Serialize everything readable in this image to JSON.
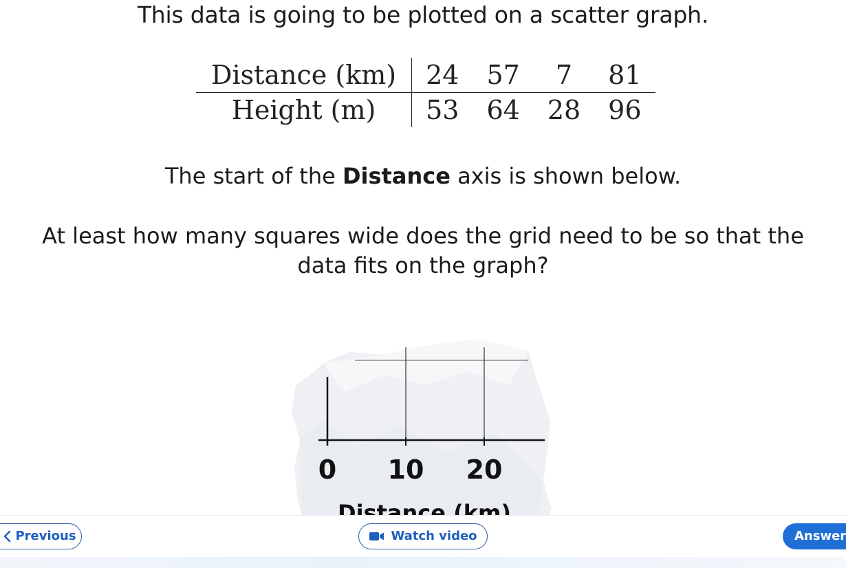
{
  "intro_text": "This data is going to be plotted on a scatter graph.",
  "table": {
    "row1_label": "Distance (km)",
    "row1_values": [
      "24",
      "57",
      "7",
      "81"
    ],
    "row2_label": "Height (m)",
    "row2_values": [
      "53",
      "64",
      "28",
      "96"
    ]
  },
  "statement": {
    "before": "The start of the ",
    "bold": "Distance",
    "after": " axis is shown below."
  },
  "question": {
    "line1": "At least how many squares wide does the grid need to be so that the",
    "line2": "data fits on the graph?"
  },
  "figure": {
    "tick_labels": [
      "0",
      "10",
      "20"
    ],
    "axis_title": "Distance (km)"
  },
  "footer": {
    "previous_label": "Previous",
    "watch_video_label": "Watch video",
    "answer_label": "Answer"
  },
  "colors": {
    "button_blue": "#1f5fbf",
    "answer_blue": "#1f6fd6",
    "button_border": "#2d5f9e"
  },
  "icons": {
    "previous": "chevron-left-icon",
    "watch_video": "video-camera-icon"
  }
}
